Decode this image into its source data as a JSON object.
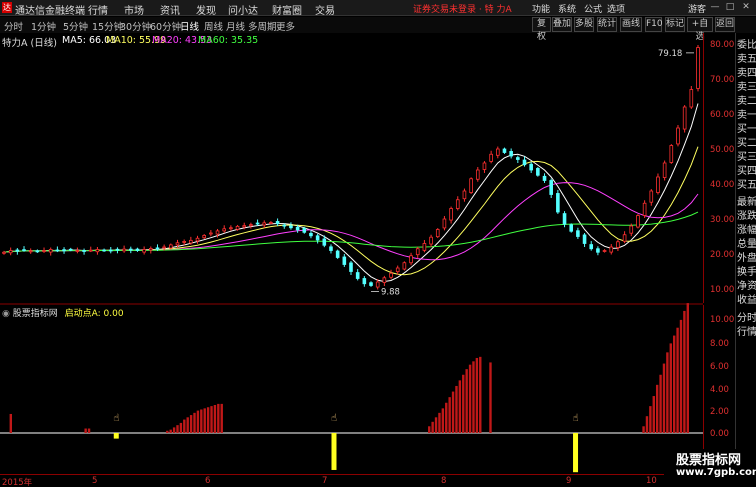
{
  "app": {
    "title": "通达信金融终端",
    "logo": "达",
    "warning": "证券交易未登录 · 特 力A"
  },
  "menu": [
    "行情",
    "市场",
    "资讯",
    "发现",
    "问小达",
    "财富圈",
    "交易"
  ],
  "right_menu": [
    "功能",
    "系统",
    "公式",
    "选项",
    "游客"
  ],
  "window_buttons": [
    "—",
    "□",
    "✕"
  ],
  "periods": [
    "分时",
    "1分钟",
    "5分钟",
    "15分钟",
    "30分钟",
    "60分钟",
    "日线",
    "周线",
    "月线",
    "多周期",
    "更多"
  ],
  "active_period": "日线",
  "toolbar": [
    "复权",
    "叠加",
    "多股",
    "统计",
    "画线",
    "F10",
    "标记",
    "+自选",
    "返回"
  ],
  "main_chart": {
    "stock_title": "特力A (日线)",
    "ma_labels": [
      {
        "text": "MA5: 66.03",
        "color": "#ffffff"
      },
      {
        "text": "MA10: 55.99",
        "color": "#ffff60"
      },
      {
        "text": "MA20: 43.53",
        "color": "#ff40ff"
      },
      {
        "text": "MA60: 35.35",
        "color": "#40ff40"
      }
    ],
    "price_ticks": [
      "80.00",
      "70.00",
      "60.00",
      "50.00",
      "40.00",
      "30.00",
      "20.00",
      "10.00"
    ],
    "high_label": "79.18",
    "low_label": "9.88"
  },
  "side_panel": [
    "委比",
    "卖五",
    "卖四",
    "卖三",
    "卖二",
    "卖一",
    "买一",
    "买二",
    "买三",
    "买四",
    "买五",
    "最新",
    "涨跌",
    "涨幅",
    "总量",
    "外盘",
    "换手",
    "净资",
    "收益",
    "分时",
    "行情"
  ],
  "indicator": {
    "name": "股票指标网",
    "param": "启动点A: 0.00",
    "ticks": [
      "10.00",
      "8.00",
      "6.00",
      "4.00",
      "2.00",
      "0.00"
    ]
  },
  "date_axis": [
    "2015年",
    "5",
    "6",
    "7",
    "8",
    "9",
    "10"
  ],
  "watermark": {
    "name": "股票指标网",
    "url": "www.7gpb.com"
  },
  "chart_data": [
    {
      "type": "candlestick",
      "title": "特力A (日线)",
      "ylim": [
        5,
        85
      ],
      "y_ticks": [
        10,
        20,
        30,
        40,
        50,
        60,
        70,
        80
      ],
      "x_ticks": [
        "2015年",
        "5",
        "6",
        "7",
        "8",
        "9",
        "10"
      ],
      "annotations": [
        {
          "text": "79.18",
          "value": 79.18
        },
        {
          "text": "9.88",
          "value": 9.88
        }
      ],
      "close": [
        20.5,
        21.0,
        20.8,
        21.2,
        20.9,
        20.7,
        21.0,
        21.3,
        21.1,
        20.9,
        21.2,
        21.0,
        20.8,
        21.1,
        21.3,
        21.0,
        20.9,
        21.2,
        21.4,
        21.1,
        21.0,
        21.3,
        21.6,
        21.4,
        22.0,
        22.6,
        23.2,
        23.6,
        23.9,
        24.5,
        25.3,
        26.0,
        26.6,
        27.2,
        27.5,
        27.9,
        28.1,
        28.4,
        28.6,
        28.9,
        29.0,
        28.7,
        28.2,
        27.5,
        26.9,
        26.2,
        25.2,
        24.0,
        22.5,
        21.0,
        19.0,
        17.0,
        15.0,
        13.0,
        11.5,
        11.0,
        12.0,
        13.2,
        14.5,
        16.0,
        17.5,
        19.5,
        21.5,
        23.0,
        24.8,
        27.0,
        30.0,
        33.0,
        35.5,
        38.0,
        41.5,
        44.0,
        46.0,
        48.5,
        50.0,
        49.0,
        48.0,
        47.0,
        45.5,
        44.0,
        42.5,
        41.0,
        37.0,
        32.0,
        28.5,
        26.5,
        25.0,
        23.0,
        21.5,
        20.5,
        21.0,
        22.0,
        23.5,
        25.5,
        28.0,
        31.0,
        34.5,
        38.0,
        42.0,
        46.0,
        51.0,
        56.0,
        62.0,
        67.0,
        79.0
      ],
      "ma": [
        {
          "name": "MA5",
          "color": "#ffffff"
        },
        {
          "name": "MA10",
          "color": "#ffff60"
        },
        {
          "name": "MA20",
          "color": "#ff40ff"
        },
        {
          "name": "MA60",
          "color": "#40ff40"
        }
      ]
    },
    {
      "type": "bar",
      "title": "股票指标网",
      "ylim": [
        0,
        11
      ],
      "y_ticks": [
        0,
        2,
        4,
        6,
        8,
        10
      ],
      "red_bars": [
        {
          "i": 2,
          "v": 1.7
        },
        {
          "i": 24,
          "v": 0.4
        },
        {
          "i": 25,
          "v": 0.4
        },
        {
          "i": 48,
          "v": 0.2
        },
        {
          "i": 49,
          "v": 0.3
        },
        {
          "i": 50,
          "v": 0.5
        },
        {
          "i": 51,
          "v": 0.7
        },
        {
          "i": 52,
          "v": 0.9
        },
        {
          "i": 53,
          "v": 1.2
        },
        {
          "i": 54,
          "v": 1.4
        },
        {
          "i": 55,
          "v": 1.6
        },
        {
          "i": 56,
          "v": 1.8
        },
        {
          "i": 57,
          "v": 2.0
        },
        {
          "i": 58,
          "v": 2.1
        },
        {
          "i": 59,
          "v": 2.2
        },
        {
          "i": 60,
          "v": 2.3
        },
        {
          "i": 61,
          "v": 2.4
        },
        {
          "i": 62,
          "v": 2.5
        },
        {
          "i": 63,
          "v": 2.6
        },
        {
          "i": 64,
          "v": 2.6
        },
        {
          "i": 125,
          "v": 0.6
        },
        {
          "i": 126,
          "v": 1.0
        },
        {
          "i": 127,
          "v": 1.4
        },
        {
          "i": 128,
          "v": 1.8
        },
        {
          "i": 129,
          "v": 2.2
        },
        {
          "i": 130,
          "v": 2.7
        },
        {
          "i": 131,
          "v": 3.2
        },
        {
          "i": 132,
          "v": 3.7
        },
        {
          "i": 133,
          "v": 4.2
        },
        {
          "i": 134,
          "v": 4.7
        },
        {
          "i": 135,
          "v": 5.2
        },
        {
          "i": 136,
          "v": 5.7
        },
        {
          "i": 137,
          "v": 6.1
        },
        {
          "i": 138,
          "v": 6.4
        },
        {
          "i": 139,
          "v": 6.7
        },
        {
          "i": 140,
          "v": 6.8
        },
        {
          "i": 143,
          "v": 6.3
        },
        {
          "i": 188,
          "v": 0.6
        },
        {
          "i": 189,
          "v": 1.5
        },
        {
          "i": 190,
          "v": 2.4
        },
        {
          "i": 191,
          "v": 3.3
        },
        {
          "i": 192,
          "v": 4.3
        },
        {
          "i": 193,
          "v": 5.2
        },
        {
          "i": 194,
          "v": 6.2
        },
        {
          "i": 195,
          "v": 7.2
        },
        {
          "i": 196,
          "v": 8.0
        },
        {
          "i": 197,
          "v": 8.7
        },
        {
          "i": 198,
          "v": 9.4
        },
        {
          "i": 199,
          "v": 10.1
        },
        {
          "i": 200,
          "v": 10.9
        },
        {
          "i": 201,
          "v": 11.6
        }
      ],
      "yellow_bars": [
        {
          "i": 33,
          "v": -0.5
        },
        {
          "i": 97,
          "v": -3.3
        },
        {
          "i": 168,
          "v": -3.5
        }
      ]
    }
  ]
}
